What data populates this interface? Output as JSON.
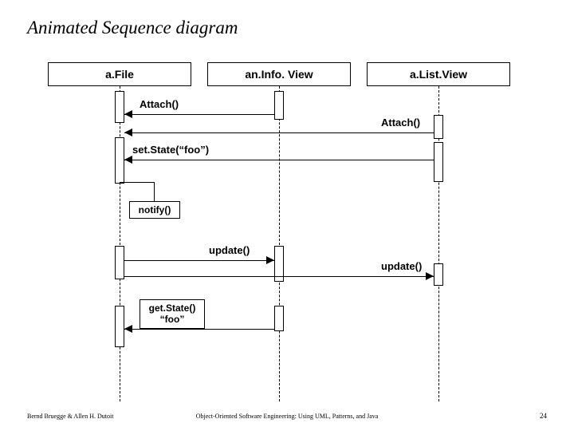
{
  "title": "Animated Sequence diagram",
  "participants": {
    "p1": "a.File",
    "p2": "an.Info. View",
    "p3": "a.List.View"
  },
  "messages": {
    "attach1": "Attach()",
    "attach2": "Attach()",
    "setstate": "set.State(“foo”)",
    "notify": "notify()",
    "update1": "update()",
    "update2": "update()",
    "getstate_l1": "get.State()",
    "getstate_l2": "“foo”"
  },
  "footer": {
    "left": "Bernd Bruegge & Allen H. Dutoit",
    "center": "Object-Oriented Software Engineering: Using UML, Patterns, and Java",
    "page": "24"
  },
  "chart_data": {
    "type": "sequence-diagram",
    "participants": [
      "a.File",
      "an.Info.View",
      "a.List.View"
    ],
    "messages": [
      {
        "from": "an.Info.View",
        "to": "a.File",
        "label": "Attach()"
      },
      {
        "from": "a.List.View",
        "to": "a.File",
        "label": "Attach()"
      },
      {
        "from": "a.List.View",
        "to": "a.File",
        "label": "set.State(\"foo\")"
      },
      {
        "from": "a.File",
        "to": "a.File",
        "label": "notify()",
        "self": true
      },
      {
        "from": "a.File",
        "to": "an.Info.View",
        "label": "update()"
      },
      {
        "from": "a.File",
        "to": "a.List.View",
        "label": "update()"
      },
      {
        "from": "an.Info.View",
        "to": "a.File",
        "label": "get.State() \"foo\""
      }
    ]
  }
}
